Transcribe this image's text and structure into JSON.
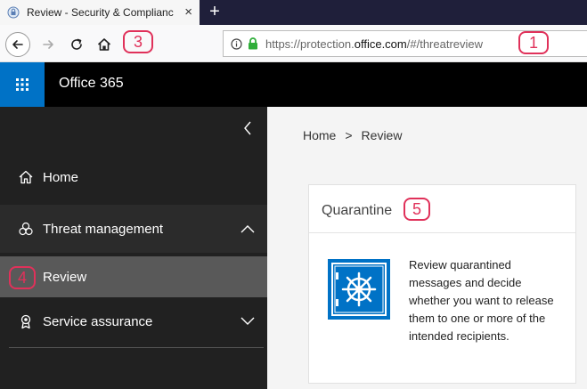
{
  "browser": {
    "tab_title": "Review - Security & Complianc",
    "tab_close": "×",
    "new_tab": "+",
    "url_prefix": "https://protection.",
    "url_domain": "office.com",
    "url_suffix": "/#/threatreview"
  },
  "callouts": {
    "c1": "1",
    "c3": "3",
    "c4": "4",
    "c5": "5"
  },
  "header": {
    "app_title": "Office 365"
  },
  "sidebar": {
    "items": [
      {
        "label": "Home",
        "icon": "home-icon"
      },
      {
        "label": "Threat management",
        "icon": "biohazard-icon",
        "expanded": true
      },
      {
        "label": "Review",
        "selected": true
      },
      {
        "label": "Service assurance",
        "icon": "ribbon-icon",
        "expanded": false
      }
    ]
  },
  "breadcrumb": {
    "home": "Home",
    "separator": ">",
    "current": "Review"
  },
  "card": {
    "title": "Quarantine",
    "description": "Review quarantined messages and decide whether you want to release them to one or more of the intended recipients.",
    "icon": "vault-icon"
  },
  "colors": {
    "accent": "#0072c6",
    "callout": "#e0315a",
    "sidebar_bg": "#212121",
    "selected_bg": "#595959",
    "lock_green": "#2fae3a"
  }
}
